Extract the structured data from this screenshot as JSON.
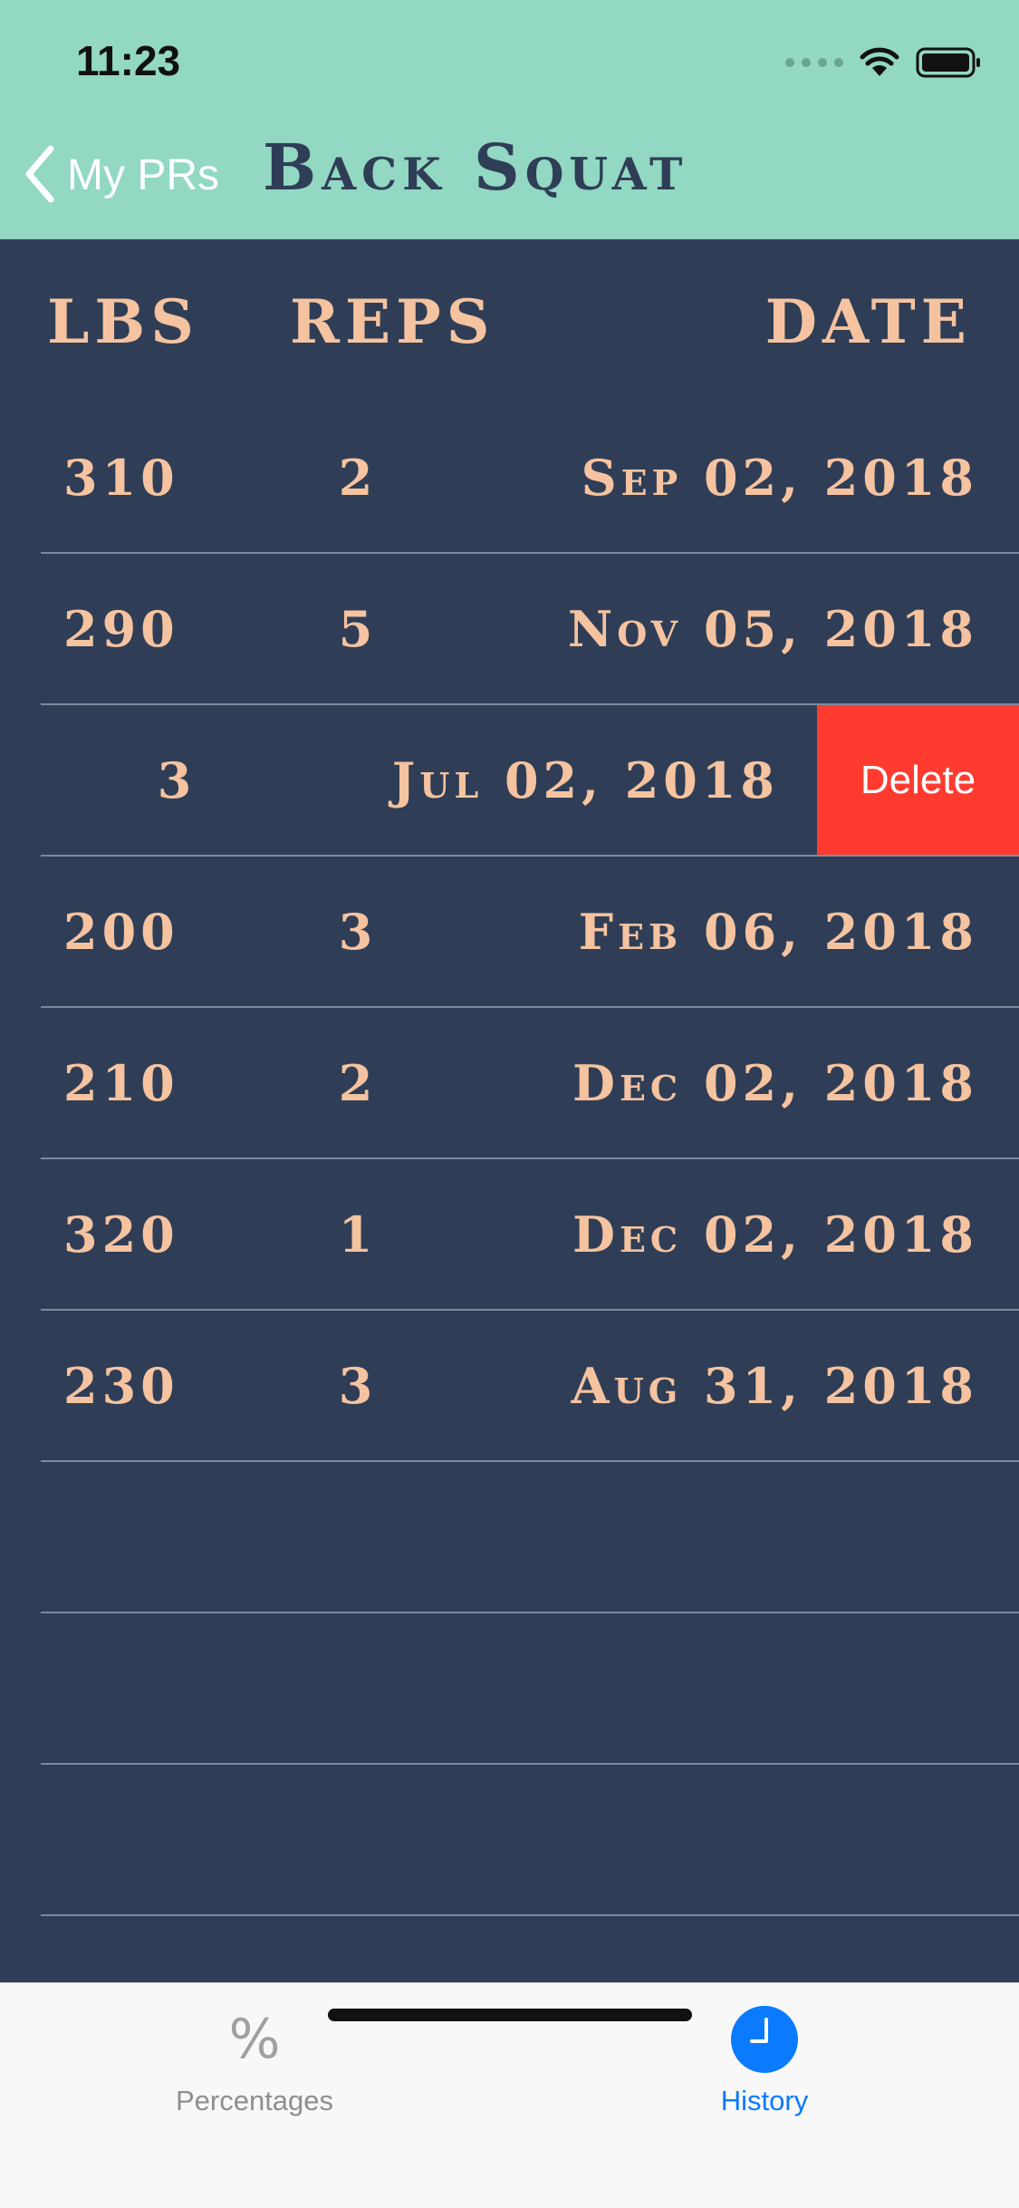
{
  "status_bar": {
    "time": "11:23"
  },
  "nav": {
    "back_label": "My PRs",
    "title": "Back Squat"
  },
  "columns": {
    "lbs": "LBS",
    "reps": "REPS",
    "date": "DATE"
  },
  "rows": [
    {
      "lbs": "310",
      "reps": "2",
      "date": "Sep 02, 2018"
    },
    {
      "lbs": "290",
      "reps": "5",
      "date": "Nov 05, 2018"
    },
    {
      "lbs": "",
      "reps": "3",
      "date": "Jul 02, 2018",
      "swiped": true
    },
    {
      "lbs": "200",
      "reps": "3",
      "date": "Feb 06, 2018"
    },
    {
      "lbs": "210",
      "reps": "2",
      "date": "Dec 02, 2018"
    },
    {
      "lbs": "320",
      "reps": "1",
      "date": "Dec 02, 2018"
    },
    {
      "lbs": "230",
      "reps": "3",
      "date": "Aug 31, 2018"
    }
  ],
  "delete_label": "Delete",
  "tabs": [
    {
      "label": "Percentages",
      "icon": "percent-icon",
      "active": false
    },
    {
      "label": "History",
      "icon": "clock-icon",
      "active": true
    }
  ],
  "colors": {
    "header_bg": "#92d8c3",
    "body_bg": "#2f3e56",
    "text_accent": "#f5c3a0",
    "delete": "#ff3b30",
    "tab_active": "#0a7aff"
  }
}
